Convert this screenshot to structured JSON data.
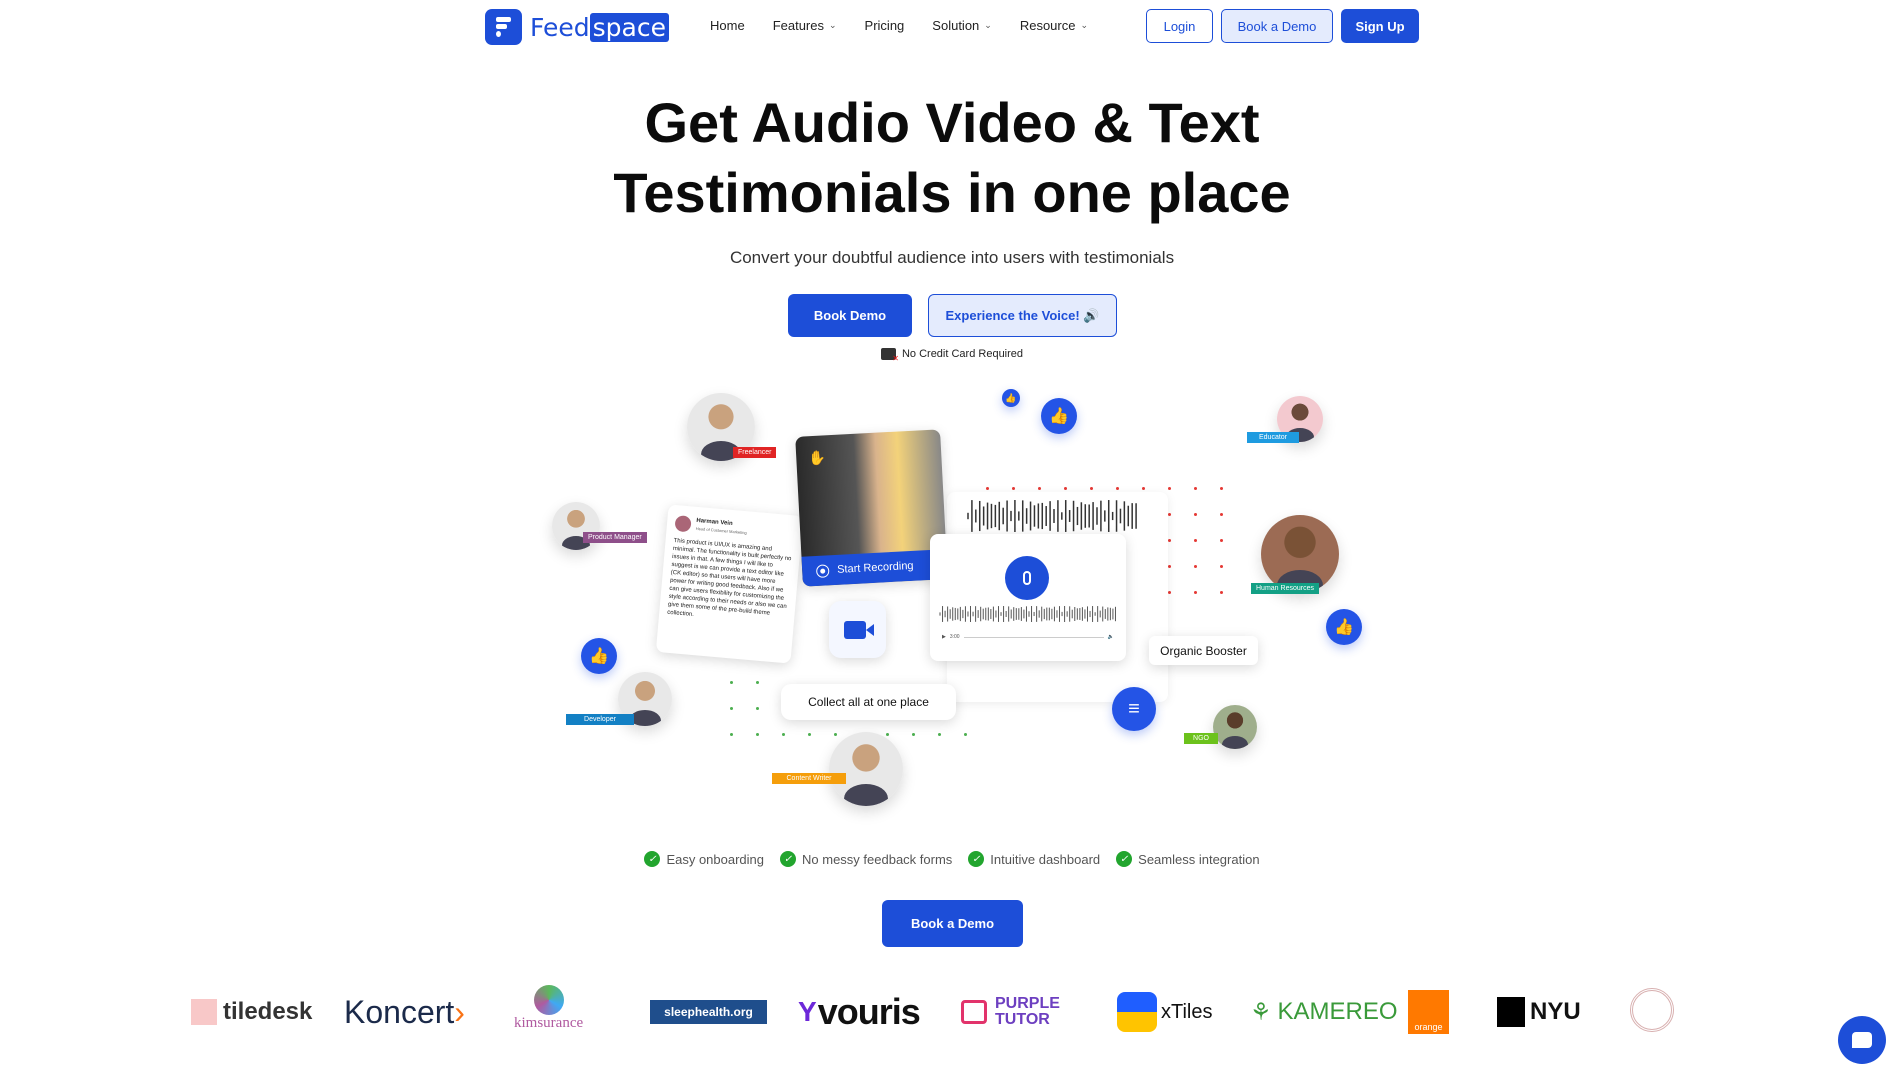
{
  "brand": {
    "name_a": "Feed",
    "name_b": "space"
  },
  "nav": {
    "items": [
      {
        "label": "Home"
      },
      {
        "label": "Features",
        "dropdown": true
      },
      {
        "label": "Pricing"
      },
      {
        "label": "Solution",
        "dropdown": true
      },
      {
        "label": "Resource",
        "dropdown": true
      }
    ],
    "login": "Login",
    "book_demo": "Book a Demo",
    "signup": "Sign Up"
  },
  "hero": {
    "title_line1": "Get Audio Video & Text",
    "title_line2": "Testimonials in one place",
    "subtitle": "Convert your doubtful audience into users with testimonials",
    "cta_primary": "Book Demo",
    "cta_secondary": "Experience the Voice! 🔊",
    "no_card": "No Credit Card Required"
  },
  "illustration": {
    "roles": {
      "freelancer": "Freelancer",
      "product_manager": "Product Manager",
      "developer": "Developer",
      "content_writer": "Content Writer",
      "educator": "Educator",
      "human_resources": "Human Resources",
      "ngo": "NGO"
    },
    "testimonial": {
      "name": "Harman Vein",
      "role": "Head of Customer Marketing",
      "text": "This product is UI/UX is amazing and minimal. The functionality is built perfectly no issues in that. A few things I will like to suggest is we can provide a text editor like (CK editor) so that users will have more power for writing good feedback. Also if we can give users flexibility for customizing the style according to their needs or also we can give them some of the pre-build theme collection."
    },
    "start_recording": "Start Recording",
    "audio_time": "3:00",
    "organic_booster": "Organic Booster",
    "collect": "Collect all at one place"
  },
  "features": [
    "Easy onboarding",
    "No messy feedback forms",
    "Intuitive dashboard",
    "Seamless integration"
  ],
  "cta_bottom": "Book a Demo",
  "logos": [
    "tiledesk",
    "Koncert",
    "kimsurance",
    "sleephealth.org",
    "vouris",
    "PURPLE TUTOR",
    "xTiles",
    "KAMEREO",
    "orange",
    "NYU"
  ],
  "colors": {
    "primary": "#1d4ed8",
    "secondary_bg": "#e4ebfd",
    "check": "#22a52e"
  }
}
